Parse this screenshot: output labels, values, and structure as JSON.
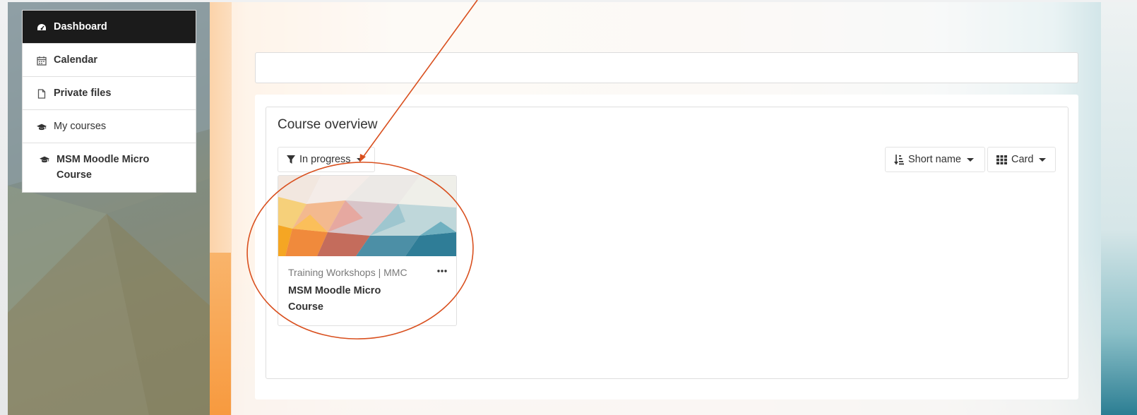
{
  "sidebar": {
    "items": [
      {
        "label": "Dashboard",
        "icon": "dashboard-icon"
      },
      {
        "label": "Calendar",
        "icon": "calendar-icon"
      },
      {
        "label": "Private files",
        "icon": "file-icon"
      },
      {
        "label": "My courses",
        "icon": "graduation-cap-icon"
      },
      {
        "label": "MSM Moodle Micro Course",
        "icon": "graduation-cap-icon"
      }
    ]
  },
  "course_overview": {
    "title": "Course overview",
    "filter_label": "In progress",
    "sort_label": "Short name",
    "view_label": "Card",
    "course": {
      "category": "Training Workshops | MMC",
      "name": "MSM Moodle Micro Course"
    }
  },
  "colors": {
    "active_nav_bg": "#1b1b1b",
    "annotation": "#d9501f"
  }
}
